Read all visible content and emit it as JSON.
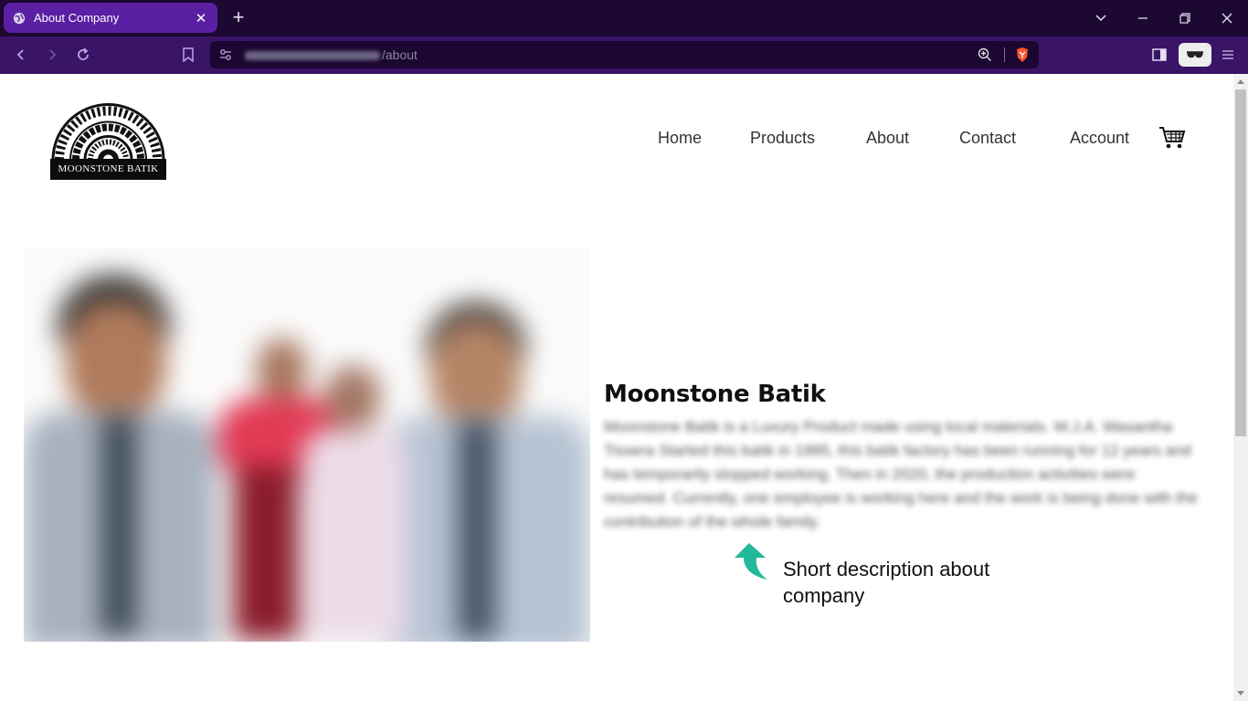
{
  "browser": {
    "tab_title": "About Company",
    "tab_close": "✕",
    "new_tab": "+",
    "url_path": "/about"
  },
  "site": {
    "logo_text": "MOONSTONE BATIK",
    "nav": [
      "Home",
      "Products",
      "About",
      "Contact",
      "Account"
    ]
  },
  "about": {
    "title": "Moonstone Batik",
    "description": "Moonstone Batik is a Luxury Product made using local materials. W.J.A. Wasantha Tissera Started this batik in 1995, this batik factory has been running for 12 years and has temporarily stopped working. Then in 2020, the production activities were resumed. Currently, one employee is working here and the work is being done with the contribution of the whole family."
  },
  "annotation": {
    "text": "Short description about company",
    "arrow_color": "#22b89a"
  },
  "colors": {
    "tabbar_bg": "#1c0833",
    "toolbar_bg": "#3a1466",
    "active_tab": "#5a1fa3"
  }
}
